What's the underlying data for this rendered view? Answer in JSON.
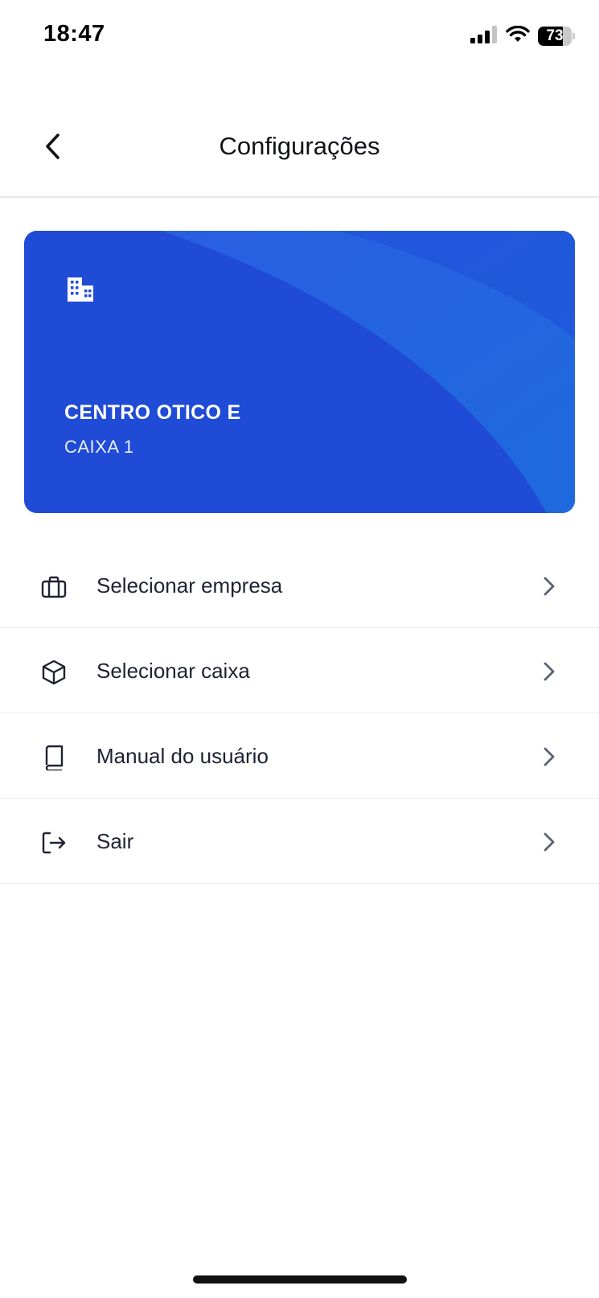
{
  "status_bar": {
    "time": "18:47",
    "battery_level": "73",
    "icons": [
      "cellular-signal-icon",
      "wifi-icon",
      "battery-icon"
    ]
  },
  "header": {
    "title": "Configurações",
    "back_icon": "chevron-left-icon"
  },
  "company_card": {
    "icon": "building-icon",
    "company_name": "CENTRO OTICO E",
    "register_name": "CAIXA 1",
    "colors": {
      "primary": "#1f4fd8",
      "accent": "#2f6fe6"
    }
  },
  "menu": {
    "items": [
      {
        "label": "Selecionar empresa",
        "icon": "briefcase-icon"
      },
      {
        "label": "Selecionar caixa",
        "icon": "cube-icon"
      },
      {
        "label": "Manual do usuário",
        "icon": "book-icon"
      },
      {
        "label": "Sair",
        "icon": "logout-icon"
      }
    ]
  }
}
